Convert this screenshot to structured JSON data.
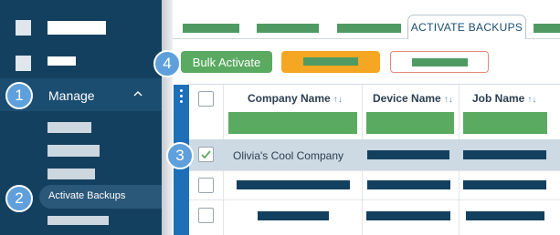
{
  "sidebar": {
    "manage_label": "Manage",
    "active_item_label": "Activate Backups"
  },
  "badges": [
    "1",
    "2",
    "3",
    "4"
  ],
  "tabs": {
    "active_label": "ACTIVATE BACKUPS"
  },
  "toolbar": {
    "bulk_activate_label": "Bulk Activate"
  },
  "table": {
    "columns": [
      "Company Name",
      "Device Name",
      "Job Name"
    ],
    "sort_glyph": "↑↓",
    "selected_row": {
      "company": "Olivia's Cool Company",
      "checked": true
    }
  },
  "colors": {
    "sidebar_bg": "#14405f",
    "accent_green": "#5aaa62",
    "accent_orange": "#f5a623",
    "badge_blue": "#5fa0dc",
    "row_selected": "#cdd9e3"
  }
}
